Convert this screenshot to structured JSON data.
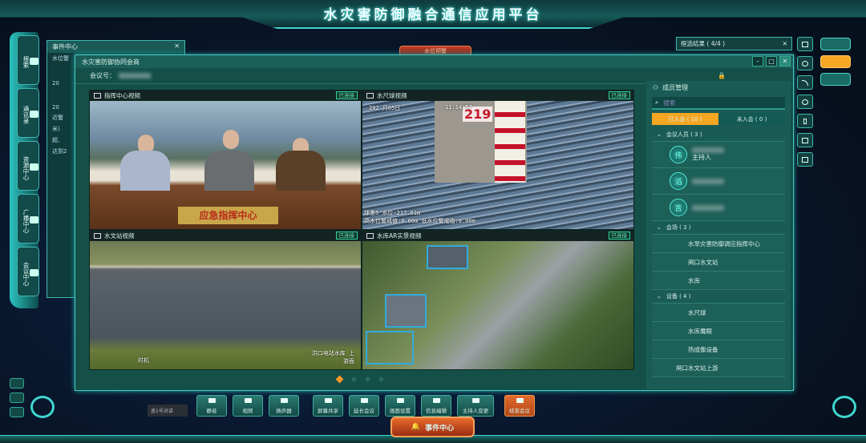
{
  "app": {
    "title": "水灾害防御融合通信应用平台",
    "alert_tab": "水位预警"
  },
  "left_nav": {
    "items": [
      {
        "label": "搜索"
      },
      {
        "label": "通讯录"
      },
      {
        "label": "资源中心"
      },
      {
        "label": "广播中心"
      },
      {
        "label": "会议中心"
      }
    ]
  },
  "event_panel": {
    "title": "事件中心",
    "subtitle": "水位警",
    "close": "✕",
    "rows": [
      "20",
      "20",
      "近警",
      "米)",
      "超,",
      "达到2"
    ]
  },
  "filter": {
    "label": "框选结果 ( 4/4 )",
    "close": "✕"
  },
  "meeting": {
    "title": "水灾害防御协同会商",
    "meeting_id_label": "会议号：",
    "controls": {
      "minimize": "–",
      "maximize": "□",
      "close": "✕"
    },
    "videos": [
      {
        "title": "指挥中心视频",
        "status": "已连接",
        "plaque": "应急指挥中心"
      },
      {
        "title": "水尺球视频",
        "status": "已连接",
        "date": "202  月05日",
        "time": "11:14:57",
        "gauge": "219",
        "overlay1": "球墨5  水位:217.61m",
        "overlay2": "高水位警戒值:0.00m   低水位警戒值:0.00m"
      },
      {
        "title": "水文站视频",
        "status": "已连接",
        "caption": "洪口电站水库 上游面",
        "caption2": "时机"
      },
      {
        "title": "水库AR实景视频",
        "status": "已连接"
      }
    ],
    "pages": {
      "total": 4,
      "current": 1
    }
  },
  "members": {
    "title": "成员管理",
    "search_placeholder": "搜索",
    "tabs": [
      {
        "label": "已入会 ( 10 )",
        "active": true
      },
      {
        "label": "未入会 ( 0 )",
        "active": false
      }
    ],
    "groups": [
      {
        "label": "会议人员 ( 3 )",
        "people": [
          {
            "avatar": "伟",
            "role": "主持人"
          },
          {
            "avatar": "滔",
            "role": ""
          },
          {
            "avatar": "吉",
            "role": ""
          }
        ]
      },
      {
        "label": "会场 ( 3 )",
        "items": [
          "水旱灾害防御调应指挥中心",
          "闸口水文站",
          "水库"
        ]
      },
      {
        "label": "设备 ( 4 )",
        "items": [
          "水尺球",
          "水库鹰眼",
          "热成像设备",
          "闸口水文站上游"
        ]
      }
    ]
  },
  "toolbar": {
    "speaker_label": "遥1号对讲",
    "buttons": [
      {
        "label": "静音",
        "icon": "microphone-icon"
      },
      {
        "label": "视频",
        "icon": "camera-icon"
      },
      {
        "label": "扬声器",
        "icon": "speaker-icon"
      },
      {
        "label": "屏幕共享",
        "icon": "monitor-icon"
      },
      {
        "label": "延长会议",
        "icon": "clock-icon"
      },
      {
        "label": "画面设置",
        "icon": "layout-icon"
      },
      {
        "label": "信息编辑",
        "icon": "pen-icon"
      },
      {
        "label": "主持人变更",
        "icon": "user-icon"
      },
      {
        "label": "结束会议",
        "icon": "hangup-icon"
      }
    ]
  },
  "event_center_button": "事件中心",
  "colors": {
    "accent": "#f5a623",
    "teal": "#3fd6d0",
    "panel": "#145048",
    "end": "#e26a2c"
  }
}
